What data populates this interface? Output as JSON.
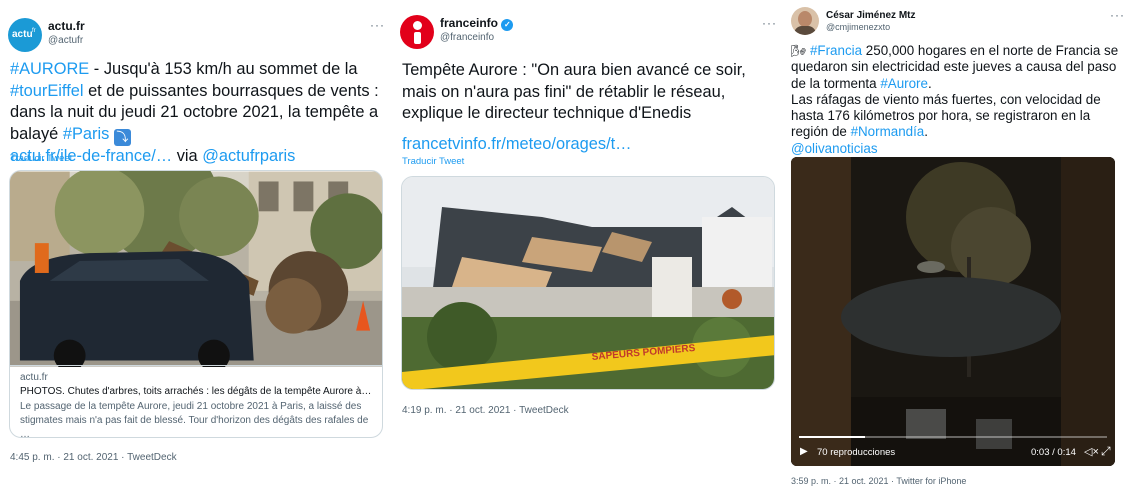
{
  "tweets": [
    {
      "author_name": "actu.fr",
      "handle": "@actufr",
      "avatar_text": "actu",
      "avatar_text_sup": "fr",
      "body": {
        "hashtag_aurore": "#AURORE",
        "t1": " - Jusqu'à 153 km/h au sommet de la ",
        "hashtag_toureiffel": "#tourEiffel",
        "t2": " et de puissantes bourrasques de vents : dans la nuit du jeudi 21 octobre 2021, la tempête a balayé ",
        "hashtag_paris": "#Paris",
        "emoji": "⤵",
        "link": "actu.fr/ile-de-france/…",
        "via": " via ",
        "mention": "@actufrparis"
      },
      "translate": "Traducir Tweet",
      "card": {
        "domain": "actu.fr",
        "title": "PHOTOS. Chutes d'arbres, toits arrachés : les dégâts de la tempête Aurore à P…",
        "description": "Le passage de la tempête Aurore, jeudi 21 octobre 2021 à Paris, a laissé des stigmates mais n'a pas fait de blessé. Tour d'horizon des dégâts des rafales de …"
      },
      "timestamp": "4:45 p. m. · 21 oct. 2021 · TweetDeck"
    },
    {
      "author_name": "franceinfo",
      "handle": "@franceinfo",
      "body": {
        "text": "Tempête Aurore : \"On aura bien avancé ce soir, mais on n'aura pas fini\" de rétablir le réseau, explique le directeur technique d'Enedis",
        "link": "francetvinfo.fr/meteo/orages/t…"
      },
      "translate": "Traducir Tweet",
      "image_tape_text": "SAPEURS POMPIERS",
      "timestamp": "4:19 p. m. · 21 oct. 2021 · TweetDeck"
    },
    {
      "author_name": "César Jiménez Mtz",
      "handle": "@cmjimenezxto",
      "body": {
        "emoji": "🌬",
        "hashtag_francia": "#Francia",
        "t1": " 250,000 hogares en el norte de Francia se quedaron sin electricidad este jueves a causa del paso de la tormenta ",
        "hashtag_aurore": "#Aurore",
        "t2": ".",
        "p2_t1": "Las ráfagas de viento más fuertes, con velocidad de hasta 176 kilómetros por hora, se registraron en la región de ",
        "hashtag_normandia": "#Normandía",
        "p2_t2": ".",
        "mention": "@olivanoticias"
      },
      "video": {
        "views": "70 reproducciones",
        "time": "0:03 / 0:14",
        "progress_fraction": 0.214
      },
      "timestamp": "3:59 p. m. · 21 oct. 2021 · Twitter for iPhone"
    }
  ],
  "icons": {
    "more": "···",
    "play": "▶",
    "volume": "🔇",
    "expand": "⤢",
    "verified": "✓"
  },
  "colors": {
    "link": "#1d9bf0",
    "text": "#0f1419",
    "secondary": "#536471",
    "border": "#cfd9de",
    "actu_brand": "#1b9ad6",
    "franceinfo_brand": "#e2001a"
  }
}
